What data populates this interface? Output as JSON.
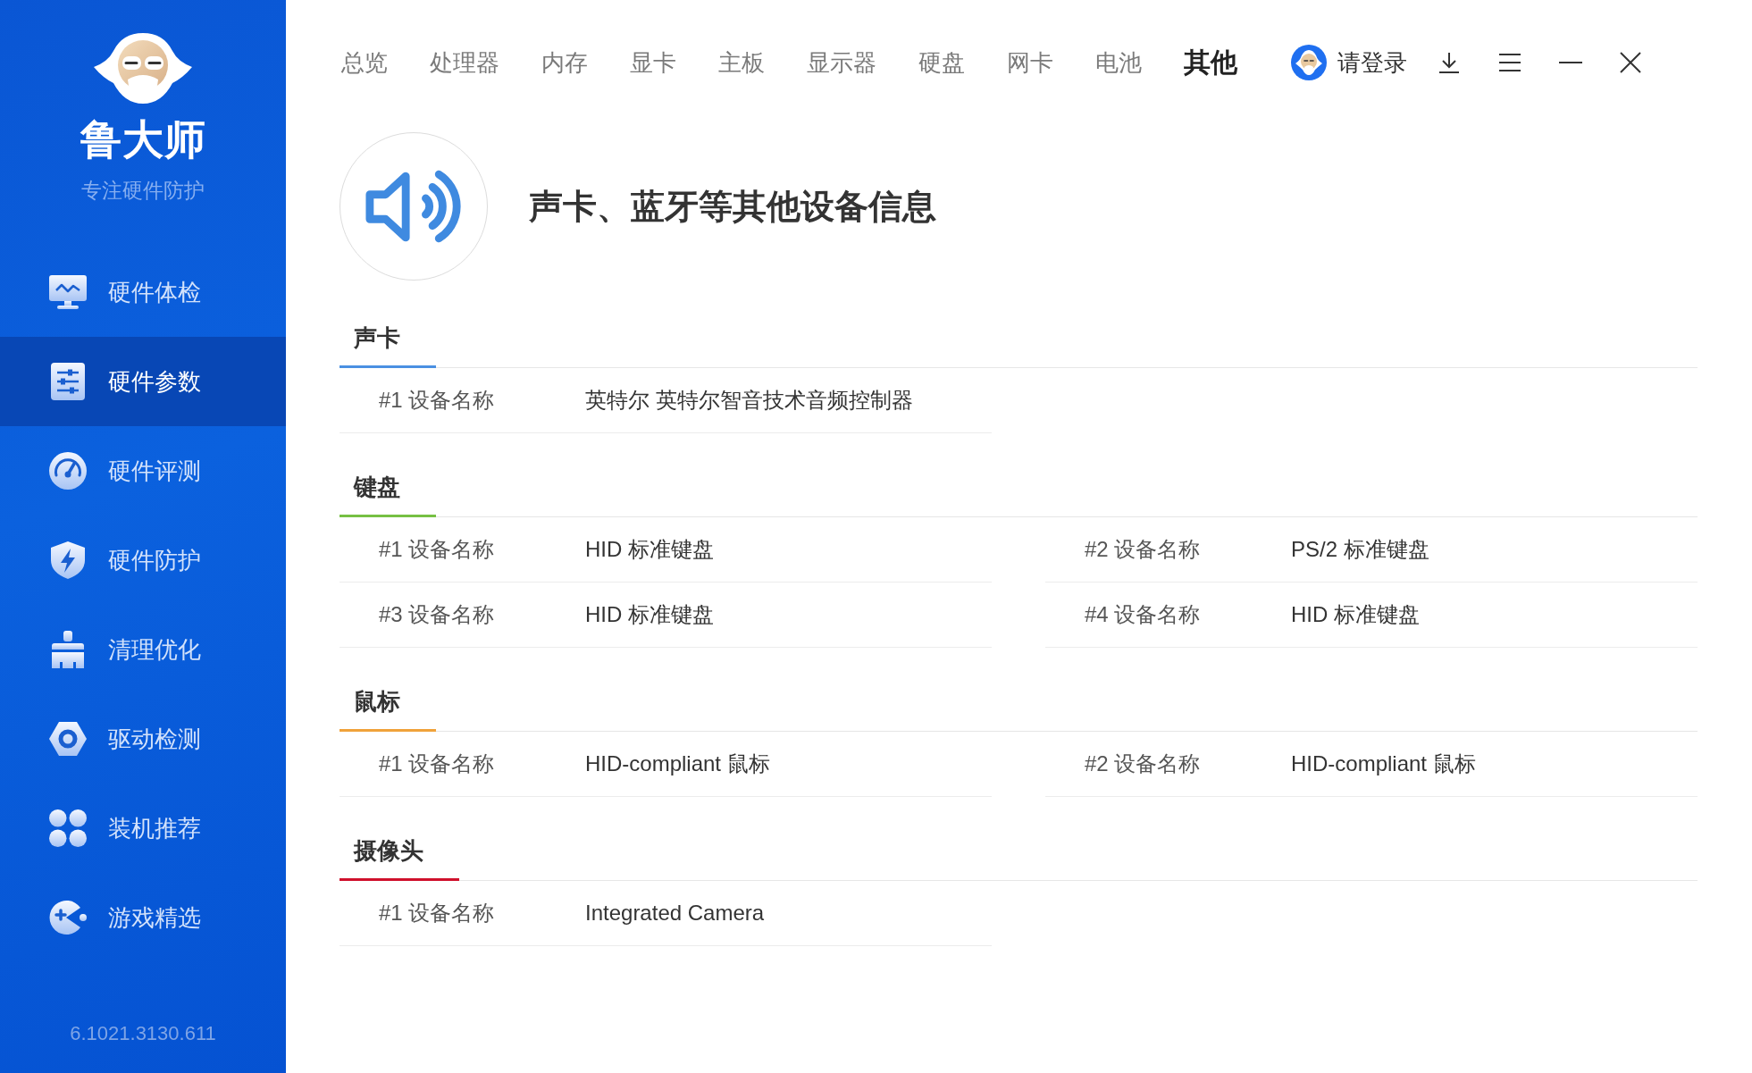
{
  "sidebar": {
    "logo_text": "鲁大师",
    "slogan": "专注硬件防护",
    "items": [
      {
        "label": "硬件体检",
        "kind": "checkup",
        "selected": false
      },
      {
        "label": "硬件参数",
        "kind": "params",
        "selected": true
      },
      {
        "label": "硬件评测",
        "kind": "benchmark",
        "selected": false
      },
      {
        "label": "硬件防护",
        "kind": "protect",
        "selected": false
      },
      {
        "label": "清理优化",
        "kind": "clean",
        "selected": false
      },
      {
        "label": "驱动检测",
        "kind": "driver",
        "selected": false
      },
      {
        "label": "装机推荐",
        "kind": "build",
        "selected": false
      },
      {
        "label": "游戏精选",
        "kind": "games",
        "selected": false
      }
    ],
    "version": "6.1021.3130.611"
  },
  "nav": {
    "tabs": [
      {
        "label": "总览",
        "selected": false
      },
      {
        "label": "处理器",
        "selected": false
      },
      {
        "label": "内存",
        "selected": false
      },
      {
        "label": "显卡",
        "selected": false
      },
      {
        "label": "主板",
        "selected": false
      },
      {
        "label": "显示器",
        "selected": false
      },
      {
        "label": "硬盘",
        "selected": false
      },
      {
        "label": "网卡",
        "selected": false
      },
      {
        "label": "电池",
        "selected": false
      },
      {
        "label": "其他",
        "selected": true
      }
    ],
    "login": "请登录"
  },
  "header": {
    "title": "声卡、蓝牙等其他设备信息"
  },
  "sections": [
    {
      "title": "声卡",
      "color": "#4a90e2",
      "devices": [
        {
          "label": "#1 设备名称",
          "value": "英特尔 英特尔智音技术音频控制器"
        }
      ]
    },
    {
      "title": "键盘",
      "color": "#76c043",
      "devices": [
        {
          "label": "#1 设备名称",
          "value": "HID 标准键盘"
        },
        {
          "label": "#2 设备名称",
          "value": "PS/2 标准键盘"
        },
        {
          "label": "#3 设备名称",
          "value": "HID 标准键盘"
        },
        {
          "label": "#4 设备名称",
          "value": "HID 标准键盘"
        }
      ]
    },
    {
      "title": "鼠标",
      "color": "#f0a23a",
      "devices": [
        {
          "label": "#1 设备名称",
          "value": "HID-compliant 鼠标"
        },
        {
          "label": "#2 设备名称",
          "value": "HID-compliant 鼠标"
        }
      ]
    },
    {
      "title": "摄像头",
      "color": "#d0102b",
      "devices": [
        {
          "label": "#1 设备名称",
          "value": "Integrated Camera"
        }
      ]
    }
  ]
}
